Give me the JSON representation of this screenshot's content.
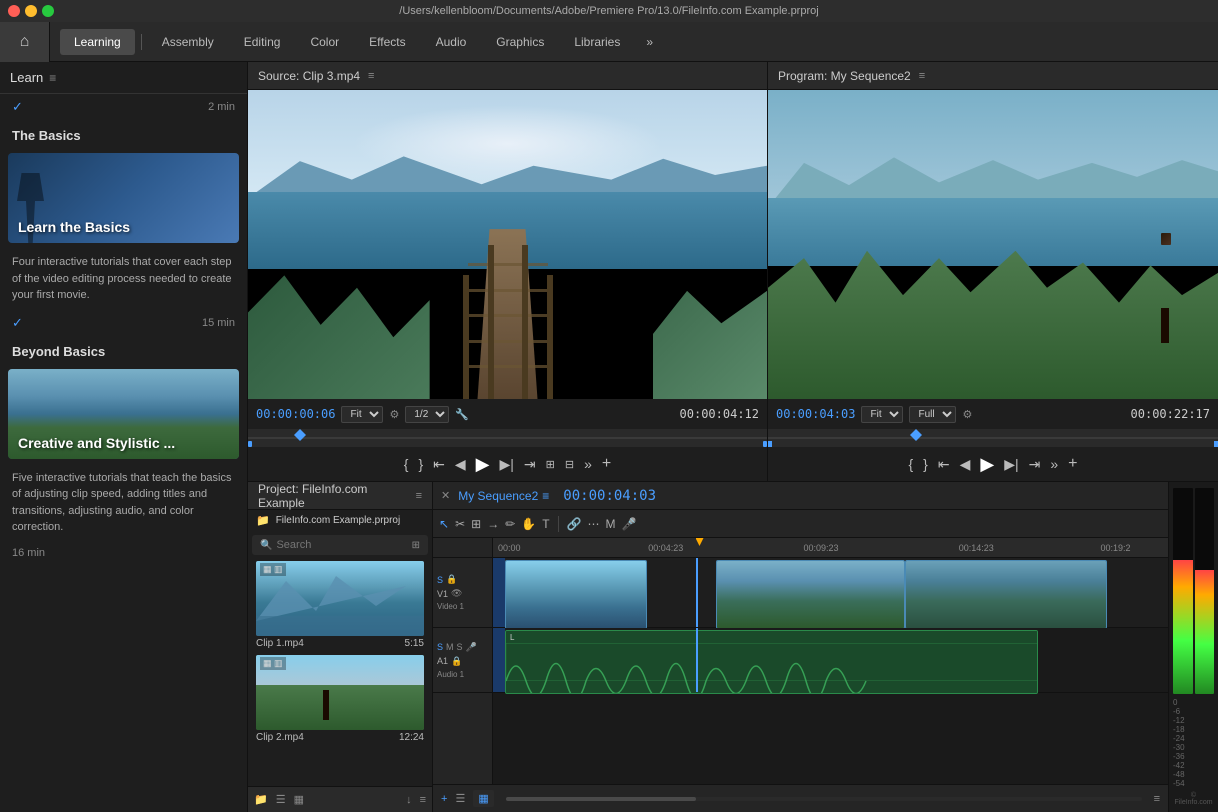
{
  "titlebar": {
    "title": "/Users/kellenbloom/Documents/Adobe/Premiere Pro/13.0/FileInfo.com Example.prproj"
  },
  "menubar": {
    "tabs": [
      "Learning",
      "Assembly",
      "Editing",
      "Color",
      "Effects",
      "Audio",
      "Graphics",
      "Libraries"
    ],
    "active_tab": "Learning",
    "more_label": "»"
  },
  "left_panel": {
    "header_label": "Learn",
    "sections": [
      {
        "id": "the-basics",
        "title": "The Basics",
        "cards": [
          {
            "title": "Learn the Basics",
            "desc": "Four interactive tutorials that cover each step of the video editing process needed to create your first movie.",
            "time": "15 min",
            "checked": true
          }
        ]
      },
      {
        "id": "beyond-basics",
        "title": "Beyond Basics",
        "cards": [
          {
            "title": "Creative and Stylistic ...",
            "desc": "Five interactive tutorials that teach the basics of adjusting clip speed, adding titles and transitions, adjusting audio, and color correction.",
            "time": "16 min",
            "checked": false
          }
        ]
      }
    ],
    "learn_time": "2 min",
    "learn_checked": true
  },
  "source_monitor": {
    "title": "Source: Clip 3.mp4",
    "timecode": "00:00:00:06",
    "fit_label": "Fit",
    "fraction": "1/2",
    "duration": "00:00:04:12"
  },
  "program_monitor": {
    "title": "Program: My Sequence2",
    "timecode": "00:00:04:03",
    "fit_label": "Fit",
    "quality_label": "Full",
    "duration": "00:00:22:17"
  },
  "project_panel": {
    "title": "Project: FileInfo.com Example",
    "file_name": "FileInfo.com Example.prproj",
    "search_placeholder": "Search",
    "clips": [
      {
        "name": "Clip 1.mp4",
        "duration": "5:15"
      },
      {
        "name": "Clip 2.mp4",
        "duration": "12:24"
      }
    ]
  },
  "timeline": {
    "sequence_name": "My Sequence2",
    "timecode": "00:00:04:03",
    "ruler_marks": [
      "00:00",
      "00:04:23",
      "00:09:23",
      "00:14:23",
      "00:19:2"
    ],
    "tracks": [
      {
        "id": "V1",
        "type": "video",
        "label": "Video 1"
      },
      {
        "id": "A1",
        "type": "audio",
        "label": "Audio 1"
      }
    ]
  },
  "icons": {
    "home": "⌂",
    "hamburger": "≡",
    "check": "✓",
    "chevron_down": "▾",
    "settings": "⚙",
    "search": "🔍",
    "play": "▶",
    "pause": "⏸",
    "stop": "⏹",
    "rewind": "⏮",
    "fast_forward": "⏭",
    "step_back": "◀",
    "step_forward": "▶",
    "mark_in": "↙",
    "mark_out": "↗",
    "loop": "⟲",
    "zoom": "⌕",
    "close": "✕",
    "folder": "📁",
    "plus": "+",
    "minus": "−",
    "list": "☰",
    "grid": "▦",
    "more": "•••"
  },
  "audio_meter": {
    "labels": [
      "0",
      "-6",
      "-12",
      "-18",
      "-24",
      "-30",
      "-36",
      "-42",
      "-48",
      "-54"
    ],
    "copyright": "© FileInfo.com"
  }
}
